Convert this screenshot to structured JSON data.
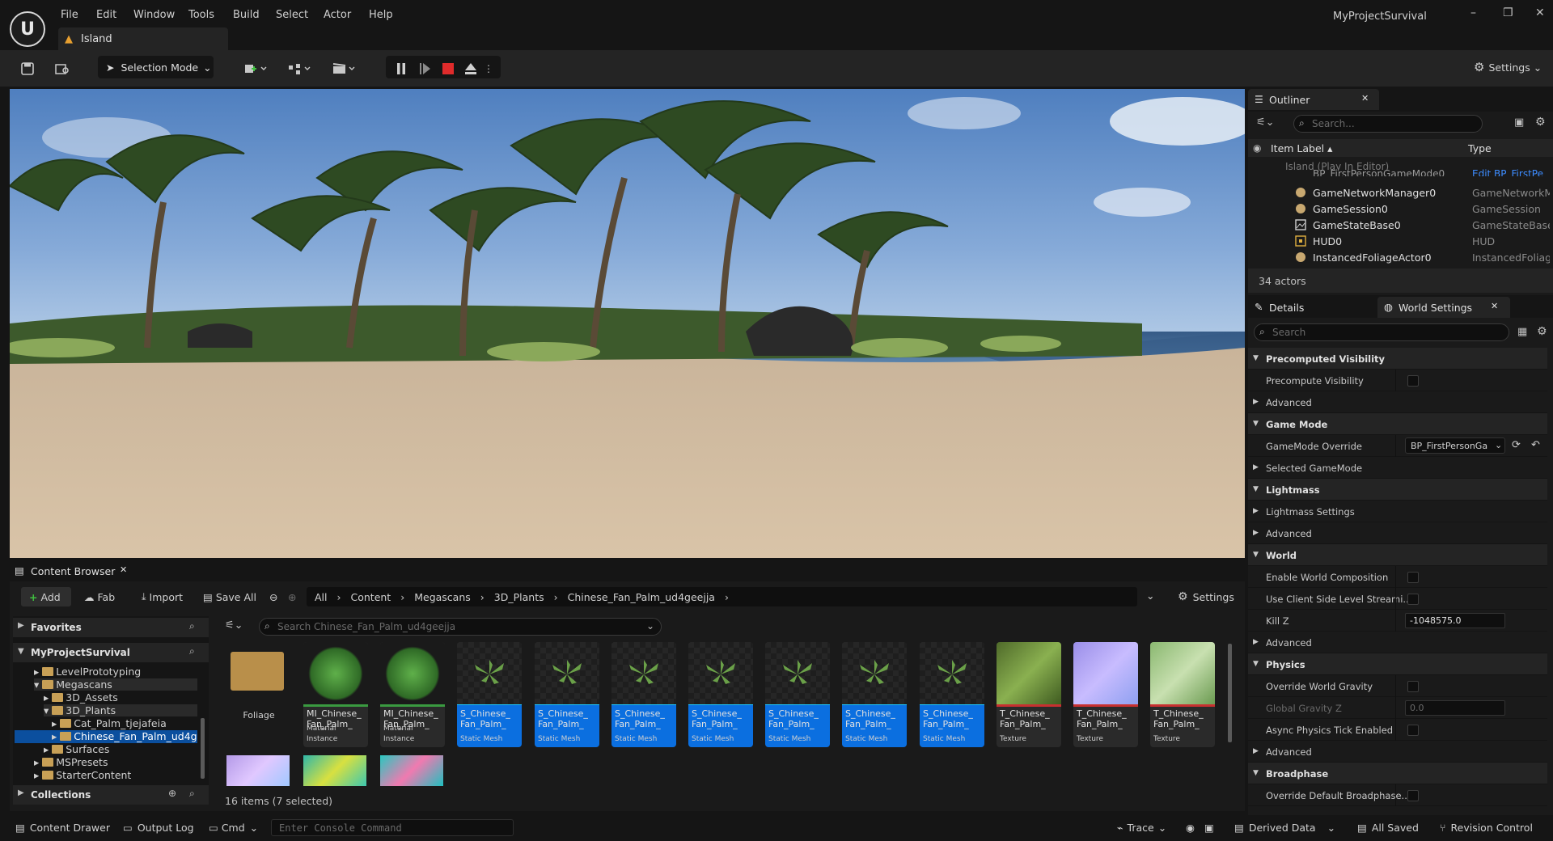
{
  "app": {
    "project_name": "MyProjectSurvival",
    "level_tab": "Island"
  },
  "menu": [
    "File",
    "Edit",
    "Window",
    "Tools",
    "Build",
    "Select",
    "Actor",
    "Help"
  ],
  "toolbar": {
    "selection_mode": "Selection Mode",
    "settings": "Settings"
  },
  "outliner": {
    "tab": "Outliner",
    "search_placeholder": "Search...",
    "col_label": "Item Label",
    "col_type": "Type",
    "root": "Island (Play In Editor)",
    "clipped_label": "BP_FirstPersonGameMode0",
    "clipped_type": "Edit BP_FirstPe",
    "rows": [
      {
        "label": "GameNetworkManager0",
        "type": "GameNetworkM"
      },
      {
        "label": "GameSession0",
        "type": "GameSession"
      },
      {
        "label": "GameStateBase0",
        "type": "GameStateBase"
      },
      {
        "label": "HUD0",
        "type": "HUD"
      },
      {
        "label": "InstancedFoliageActor0",
        "type": "InstancedFoliag"
      }
    ],
    "count": "34 actors"
  },
  "details": {
    "tab_details": "Details",
    "tab_world": "World Settings",
    "search_placeholder": "Search",
    "rows": [
      {
        "kind": "section",
        "name": "Precomputed Visibility"
      },
      {
        "kind": "check",
        "name": "Precompute Visibility"
      },
      {
        "kind": "sub",
        "name": "Advanced"
      },
      {
        "kind": "section",
        "name": "Game Mode"
      },
      {
        "kind": "dropdown",
        "name": "GameMode Override",
        "value": "BP_FirstPersonGa"
      },
      {
        "kind": "sub",
        "name": "Selected GameMode"
      },
      {
        "kind": "section",
        "name": "Lightmass"
      },
      {
        "kind": "sub",
        "name": "Lightmass Settings"
      },
      {
        "kind": "sub",
        "name": "Advanced"
      },
      {
        "kind": "section",
        "name": "World"
      },
      {
        "kind": "check",
        "name": "Enable World Composition"
      },
      {
        "kind": "check",
        "name": "Use Client Side Level Streami..."
      },
      {
        "kind": "number",
        "name": "Kill Z",
        "value": "-1048575.0"
      },
      {
        "kind": "sub",
        "name": "Advanced"
      },
      {
        "kind": "section",
        "name": "Physics"
      },
      {
        "kind": "check",
        "name": "Override World Gravity"
      },
      {
        "kind": "number-dim",
        "name": "Global Gravity Z",
        "value": "0.0"
      },
      {
        "kind": "check",
        "name": "Async Physics Tick Enabled"
      },
      {
        "kind": "sub",
        "name": "Advanced"
      },
      {
        "kind": "section",
        "name": "Broadphase"
      },
      {
        "kind": "check",
        "name": "Override Default Broadphase..."
      }
    ]
  },
  "content_browser": {
    "tab": "Content Browser",
    "add": "Add",
    "fab": "Fab",
    "import": "Import",
    "save_all": "Save All",
    "settings": "Settings",
    "path": [
      "All",
      "Content",
      "Megascans",
      "3D_Plants",
      "Chinese_Fan_Palm_ud4geejja"
    ],
    "search_placeholder": "Search Chinese_Fan_Palm_ud4geejja",
    "favorites": "Favorites",
    "project": "MyProjectSurvival",
    "tree": [
      "LevelPrototyping",
      "Megascans",
      "3D_Assets",
      "3D_Plants",
      "Cat_Palm_tjejafeia",
      "Chinese_Fan_Palm_ud4ge",
      "Surfaces",
      "MSPresets",
      "StarterContent"
    ],
    "collections": "Collections",
    "status": "16 items (7 selected)",
    "folder_name": "Foliage",
    "assets": [
      {
        "name": "MI_Chinese_ Fan_Palm_",
        "kind": "Material Instance"
      },
      {
        "name": "MI_Chinese_ Fan_Palm_",
        "kind": "Material Instance"
      },
      {
        "name": "S_Chinese_ Fan_Palm_",
        "kind": "Static Mesh"
      },
      {
        "name": "S_Chinese_ Fan_Palm_",
        "kind": "Static Mesh"
      },
      {
        "name": "S_Chinese_ Fan_Palm_",
        "kind": "Static Mesh"
      },
      {
        "name": "S_Chinese_ Fan_Palm_",
        "kind": "Static Mesh"
      },
      {
        "name": "S_Chinese_ Fan_Palm_",
        "kind": "Static Mesh"
      },
      {
        "name": "S_Chinese_ Fan_Palm_",
        "kind": "Static Mesh"
      },
      {
        "name": "S_Chinese_ Fan_Palm_",
        "kind": "Static Mesh"
      },
      {
        "name": "T_Chinese_ Fan_Palm_",
        "kind": "Texture"
      },
      {
        "name": "T_Chinese_ Fan_Palm_",
        "kind": "Texture"
      },
      {
        "name": "T_Chinese_ Fan_Palm_",
        "kind": "Texture"
      }
    ]
  },
  "statusbar": {
    "content_drawer": "Content Drawer",
    "output_log": "Output Log",
    "cmd": "Cmd",
    "console_placeholder": "Enter Console Command",
    "trace": "Trace",
    "derived_data": "Derived Data",
    "all_saved": "All Saved",
    "revision_control": "Revision Control"
  },
  "colors": {
    "accent_blue": "#0b6fe0",
    "record_red": "#e02b2b",
    "folder": "#c8a056"
  }
}
